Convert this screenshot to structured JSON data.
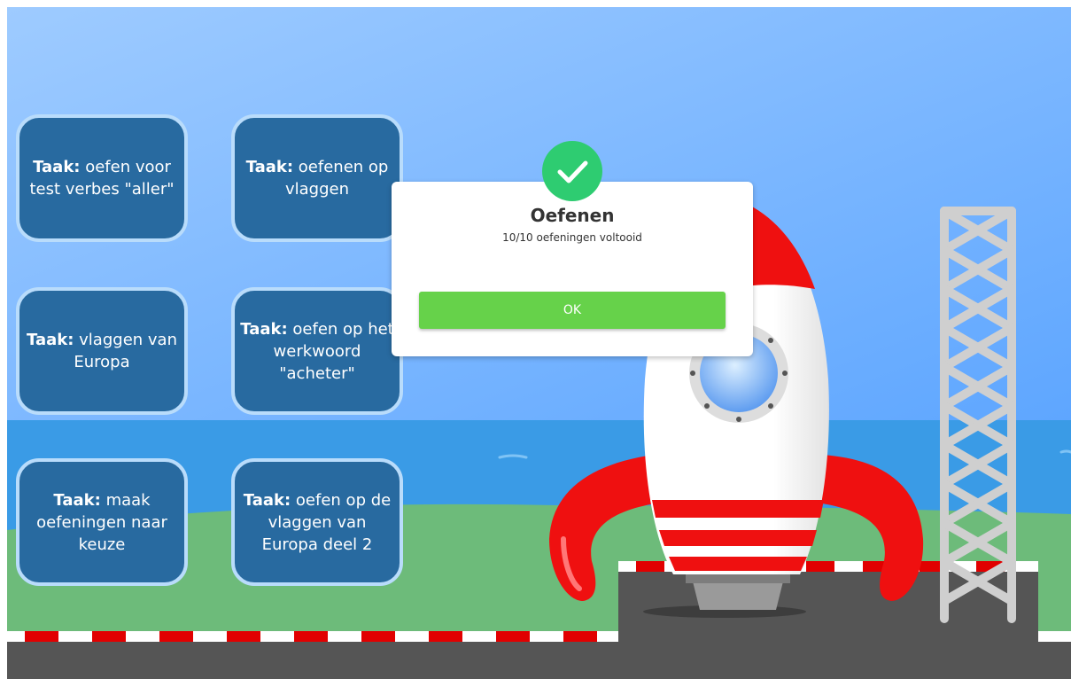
{
  "tasks": [
    {
      "prefix": "Taak:",
      "text": "oefen voor test verbes \"aller\""
    },
    {
      "prefix": "Taak:",
      "text": "oefenen op vlaggen"
    },
    {
      "prefix": "Taak:",
      "text": "vlaggen van Europa"
    },
    {
      "prefix": "Taak:",
      "text": "oefen op het werkwoord \"acheter\""
    },
    {
      "prefix": "Taak:",
      "text": "maak oefeningen naar keuze"
    },
    {
      "prefix": "Taak:",
      "text": "oefen op de vlaggen van Europa deel 2"
    }
  ],
  "dialog": {
    "title": "Oefenen",
    "subtitle": "10/10 oefeningen voltooid",
    "ok_label": "OK",
    "icon": "check-icon"
  },
  "colors": {
    "sky_top": "#9ecbff",
    "sky_bottom": "#5ea6ff",
    "sea": "#3a9be6",
    "grass": "#6dbb7a",
    "card": "#286aa0",
    "success": "#2ecc71",
    "ok_button": "#66d24a",
    "rocket_red": "#ef1010"
  }
}
